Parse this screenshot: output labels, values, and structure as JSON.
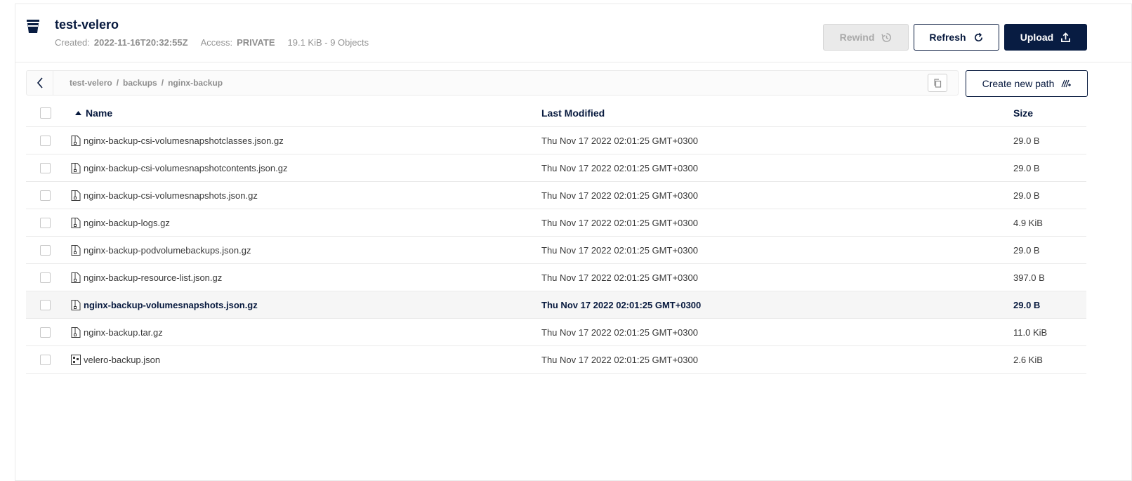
{
  "bucket": {
    "name": "test-velero",
    "created_label": "Created:",
    "created_value": "2022-11-16T20:32:55Z",
    "access_label": "Access:",
    "access_value": "PRIVATE",
    "usage": "19.1 KiB - 9 Objects"
  },
  "actions": {
    "rewind": "Rewind",
    "refresh": "Refresh",
    "upload": "Upload",
    "create_path": "Create new path"
  },
  "breadcrumb": {
    "parts": [
      "test-velero",
      "backups",
      "nginx-backup"
    ],
    "separator": "/"
  },
  "table": {
    "columns": {
      "name": "Name",
      "modified": "Last Modified",
      "size": "Size"
    },
    "rows": [
      {
        "name": "nginx-backup-csi-volumesnapshotclasses.json.gz",
        "modified": "Thu Nov 17 2022 02:01:25 GMT+0300",
        "size": "29.0 B",
        "icon": "zip-file-icon"
      },
      {
        "name": "nginx-backup-csi-volumesnapshotcontents.json.gz",
        "modified": "Thu Nov 17 2022 02:01:25 GMT+0300",
        "size": "29.0 B",
        "icon": "zip-file-icon"
      },
      {
        "name": "nginx-backup-csi-volumesnapshots.json.gz",
        "modified": "Thu Nov 17 2022 02:01:25 GMT+0300",
        "size": "29.0 B",
        "icon": "zip-file-icon"
      },
      {
        "name": "nginx-backup-logs.gz",
        "modified": "Thu Nov 17 2022 02:01:25 GMT+0300",
        "size": "4.9 KiB",
        "icon": "zip-file-icon"
      },
      {
        "name": "nginx-backup-podvolumebackups.json.gz",
        "modified": "Thu Nov 17 2022 02:01:25 GMT+0300",
        "size": "29.0 B",
        "icon": "zip-file-icon"
      },
      {
        "name": "nginx-backup-resource-list.json.gz",
        "modified": "Thu Nov 17 2022 02:01:25 GMT+0300",
        "size": "397.0 B",
        "icon": "zip-file-icon"
      },
      {
        "name": "nginx-backup-volumesnapshots.json.gz",
        "modified": "Thu Nov 17 2022 02:01:25 GMT+0300",
        "size": "29.0 B",
        "icon": "zip-file-icon"
      },
      {
        "name": "nginx-backup.tar.gz",
        "modified": "Thu Nov 17 2022 02:01:25 GMT+0300",
        "size": "11.0 KiB",
        "icon": "zip-file-icon"
      },
      {
        "name": "velero-backup.json",
        "modified": "Thu Nov 17 2022 02:01:25 GMT+0300",
        "size": "2.6 KiB",
        "icon": "json-file-icon"
      }
    ]
  },
  "colors": {
    "primary": "#081c42",
    "border": "#eaeaea",
    "muted": "#8e8e8e",
    "row_highlight": "#f6f6f6"
  }
}
